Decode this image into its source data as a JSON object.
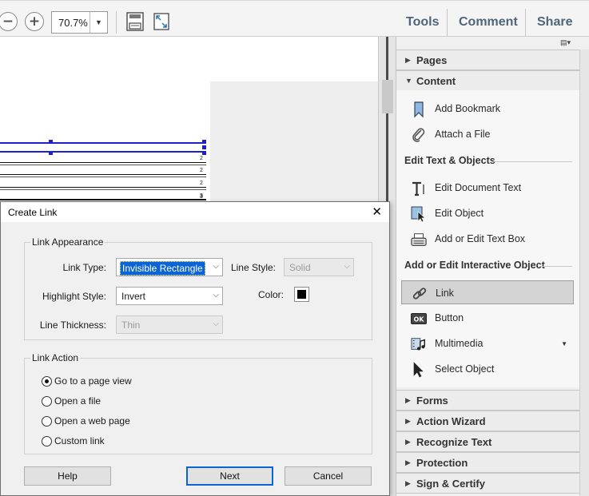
{
  "toolbar": {
    "zoom_out": "−",
    "zoom_in": "+",
    "zoom_value": "70.7%",
    "zoom_dropdown": "▼",
    "tools_label": "Tools",
    "comment_label": "Comment",
    "share_label": "Share"
  },
  "document": {
    "row_numbers": [
      "2",
      "2",
      "2",
      "3",
      "3"
    ]
  },
  "right_panel": {
    "options_glyph": "▤▾",
    "sections_top": [
      {
        "label": "Pages",
        "arrow": "▶"
      },
      {
        "label": "Content",
        "arrow": "▼"
      }
    ],
    "content_tools": [
      {
        "label": "Add Bookmark",
        "icon": "bookmark-icon"
      },
      {
        "label": "Attach a File",
        "icon": "paperclip-icon"
      }
    ],
    "group1_label": "Edit Text & Objects",
    "edit_tools": [
      {
        "label": "Edit Document Text",
        "icon": "text-cursor-icon"
      },
      {
        "label": "Edit Object",
        "icon": "edit-object-icon"
      },
      {
        "label": "Add or Edit Text Box",
        "icon": "typewriter-icon"
      }
    ],
    "group2_label": "Add or Edit Interactive Object",
    "interactive_tools": [
      {
        "label": "Link",
        "icon": "link-icon",
        "active": true
      },
      {
        "label": "Button",
        "icon": "ok-button-icon"
      },
      {
        "label": "Multimedia",
        "icon": "multimedia-icon",
        "caret": "▼"
      },
      {
        "label": "Select Object",
        "icon": "arrow-pointer-icon"
      }
    ],
    "sections_bottom": [
      {
        "label": "Forms",
        "arrow": "▶"
      },
      {
        "label": "Action Wizard",
        "arrow": "▶"
      },
      {
        "label": "Recognize Text",
        "arrow": "▶"
      },
      {
        "label": "Protection",
        "arrow": "▶"
      },
      {
        "label": "Sign & Certify",
        "arrow": "▶"
      }
    ]
  },
  "dialog": {
    "title": "Create Link",
    "close": "✕",
    "appearance": {
      "legend": "Link Appearance",
      "link_type_label": "Link Type:",
      "link_type_value": "Invisible Rectangle",
      "line_style_label": "Line Style:",
      "line_style_value": "Solid",
      "highlight_label": "Highlight Style:",
      "highlight_value": "Invert",
      "color_label": "Color:",
      "color_value": "#000000",
      "thickness_label": "Line Thickness:",
      "thickness_value": "Thin"
    },
    "action": {
      "legend": "Link Action",
      "options": [
        {
          "label": "Go to a page view",
          "selected": true
        },
        {
          "label": "Open a file",
          "selected": false
        },
        {
          "label": "Open a web page",
          "selected": false
        },
        {
          "label": "Custom link",
          "selected": false
        }
      ]
    },
    "buttons": {
      "help": "Help",
      "next": "Next",
      "cancel": "Cancel"
    }
  },
  "colors": {
    "accent": "#0a64d6",
    "selection_blue": "#1f1fd0",
    "toolbar_link": "#4f6578"
  }
}
